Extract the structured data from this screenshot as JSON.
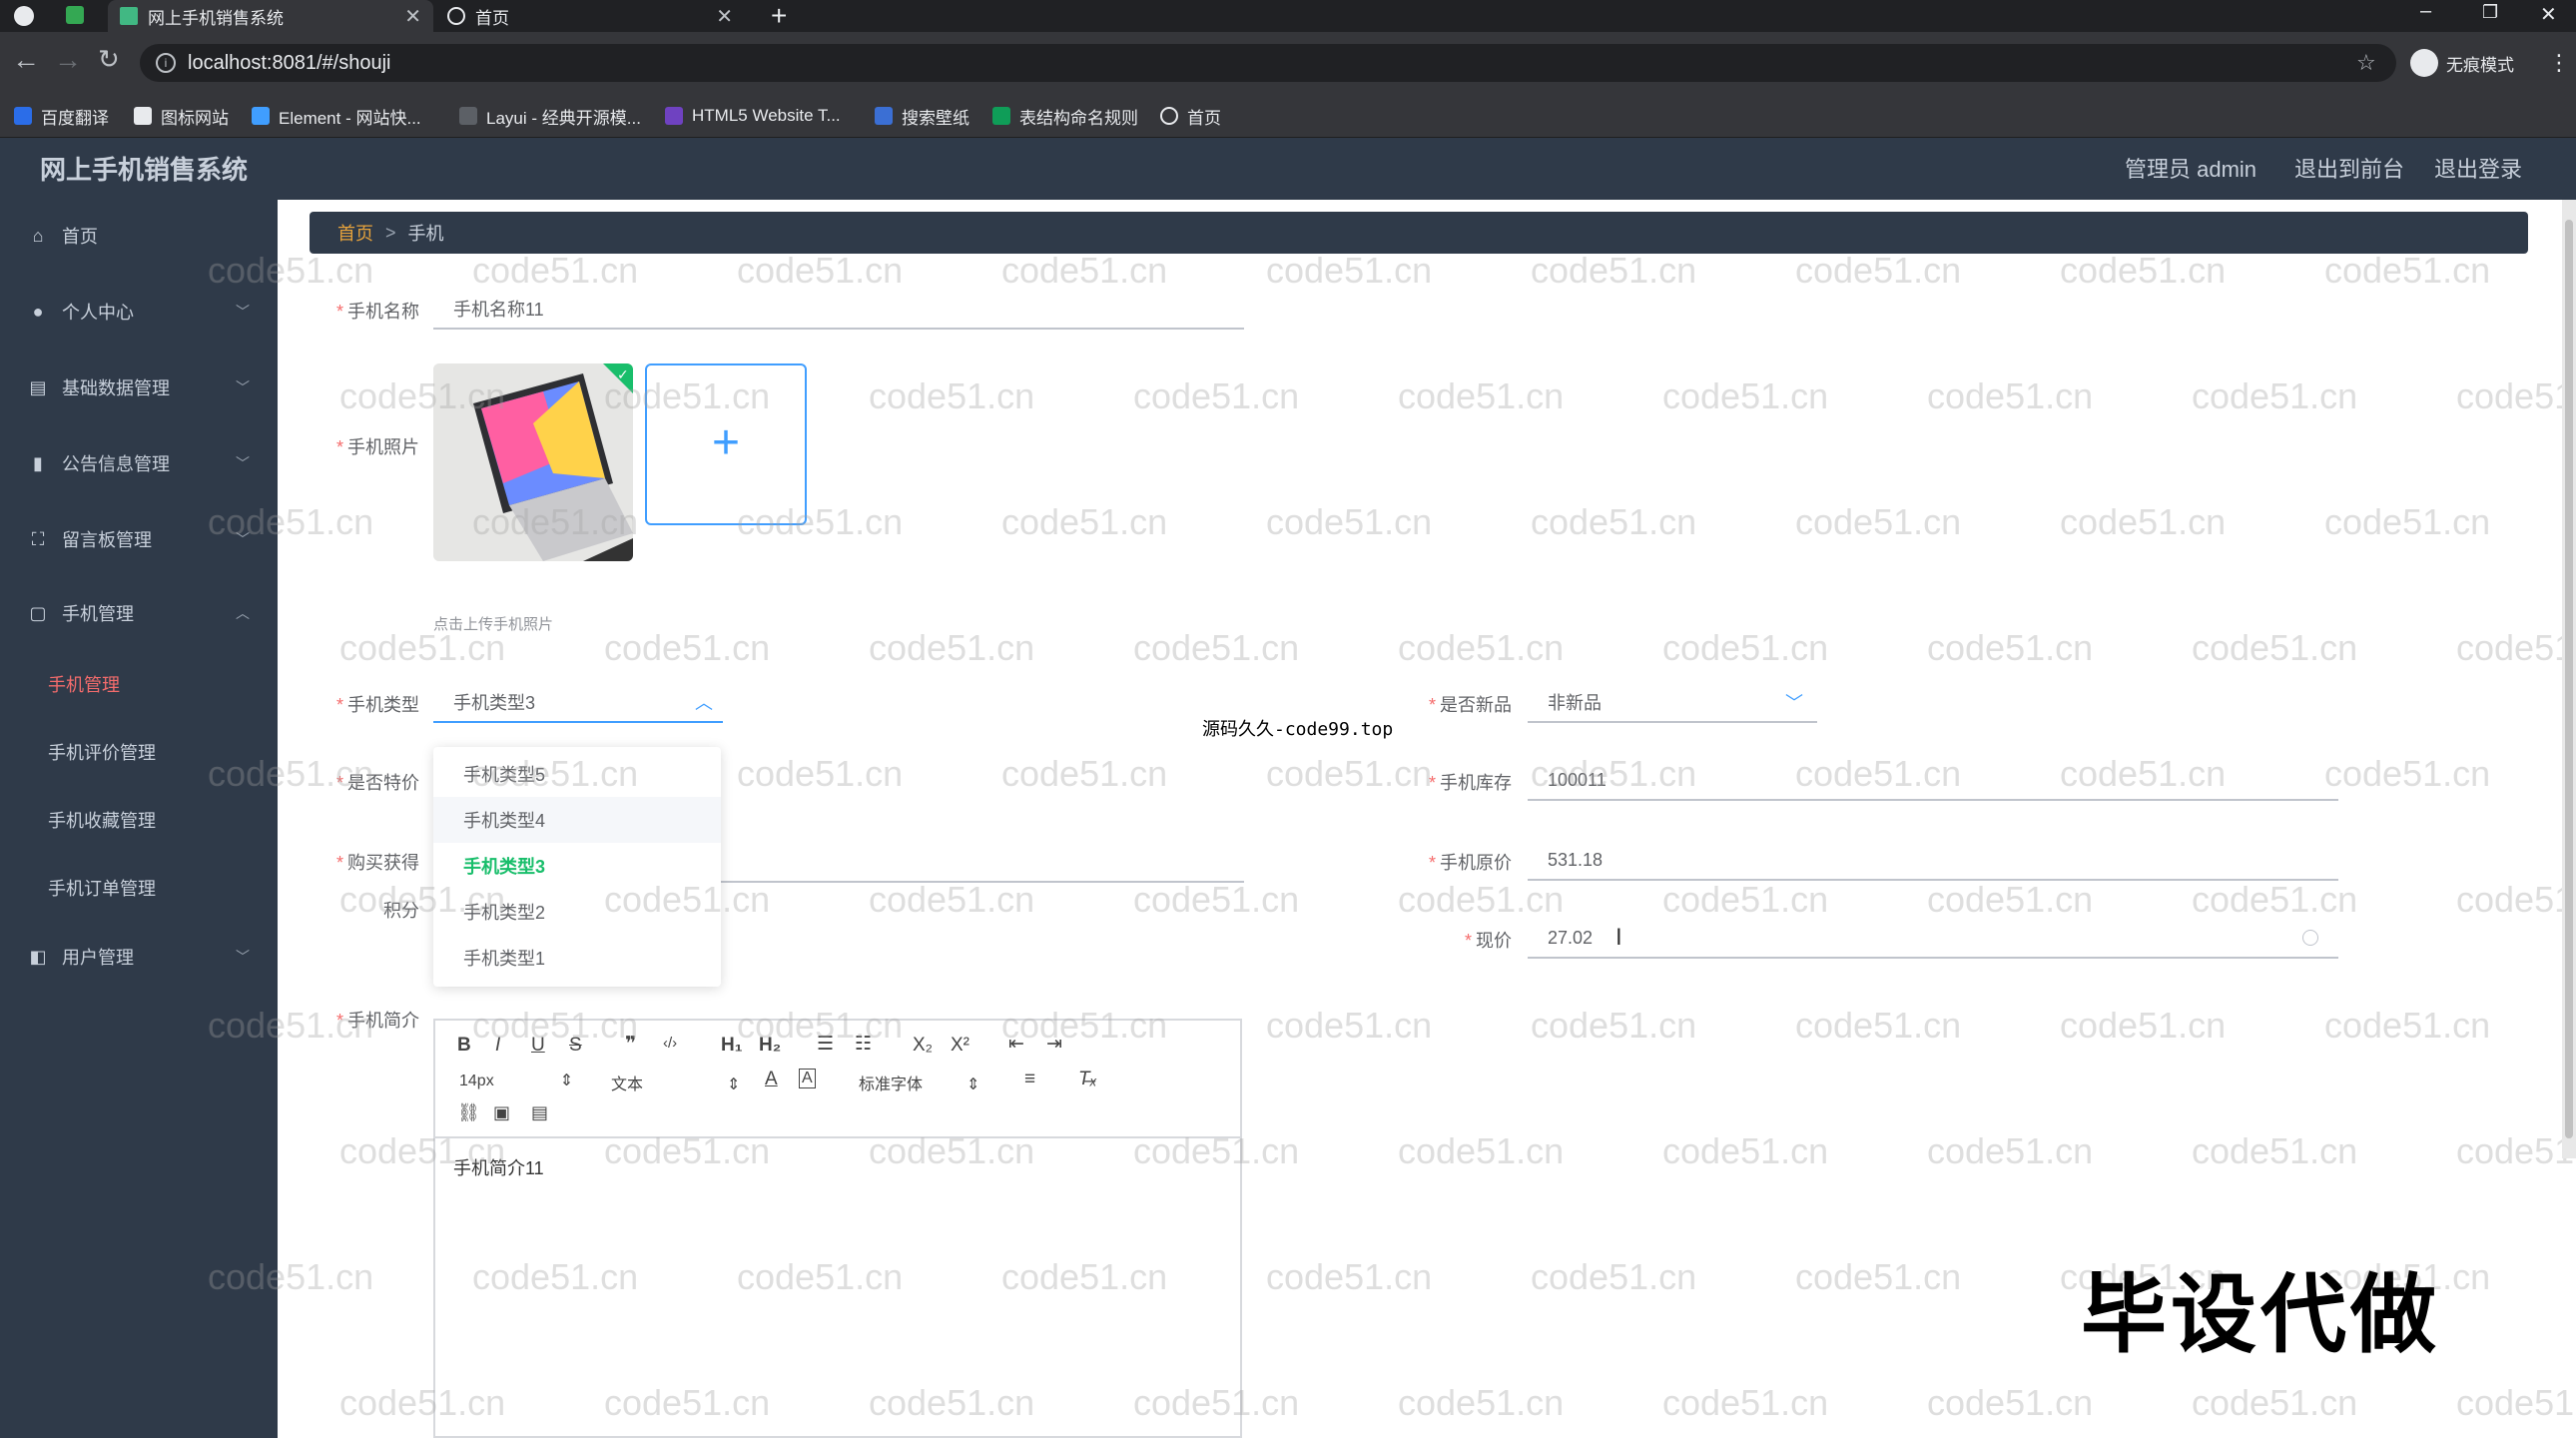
{
  "browser": {
    "tabs": [
      {
        "title": "网上手机销售系统",
        "active": true
      },
      {
        "title": "首页",
        "active": false
      }
    ],
    "url": "localhost:8081/#/shouji",
    "profile": "无痕模式",
    "bookmarks": [
      "百度翻译",
      "图标网站",
      "Element - 网站快...",
      "Layui - 经典开源模...",
      "HTML5 Website T...",
      "搜索壁纸",
      "表结构命名规则",
      "首页"
    ]
  },
  "header": {
    "app_name": "网上手机销售系统",
    "admin": "管理员 admin",
    "to_front": "退出到前台",
    "logout": "退出登录"
  },
  "sidebar": {
    "items": [
      {
        "label": "首页",
        "icon": "home-icon"
      },
      {
        "label": "个人中心",
        "icon": "user-icon"
      },
      {
        "label": "基础数据管理",
        "icon": "card-icon"
      },
      {
        "label": "公告信息管理",
        "icon": "bar-chart-icon"
      },
      {
        "label": "留言板管理",
        "icon": "frame-icon"
      },
      {
        "label": "手机管理",
        "icon": "box-icon"
      },
      {
        "label": "用户管理",
        "icon": "people-icon"
      }
    ],
    "sub_items": [
      "手机管理",
      "手机评价管理",
      "手机收藏管理",
      "手机订单管理"
    ]
  },
  "breadcrumb": {
    "home": "首页",
    "sep": ">",
    "current": "手机"
  },
  "form": {
    "name_label": "手机名称",
    "name_value": "手机名称11",
    "photo_label": "手机照片",
    "upload_tip": "点击上传手机照片",
    "type_label": "手机类型",
    "type_value": "手机类型3",
    "new_label": "是否新品",
    "new_value": "非新品",
    "special_label": "是否特价",
    "stock_label": "手机库存",
    "stock_value": "100011",
    "points_label_1": "购买获得",
    "points_label_2": "积分",
    "orig_price_label": "手机原价",
    "orig_price_value": "531.18",
    "price_label": "现价",
    "price_value": "27.02",
    "intro_label": "手机简介",
    "dropdown_options": [
      "手机类型5",
      "手机类型4",
      "手机类型3",
      "手机类型2",
      "手机类型1"
    ],
    "dropdown_selected_index": 2
  },
  "editor": {
    "font_size": "14px",
    "block_type": "文本",
    "font_family": "标准字体",
    "content": "手机简介11"
  },
  "overlay": {
    "source_text": "源码久久-code99.top",
    "stamp": "毕设代做",
    "watermark": "code51.cn"
  }
}
